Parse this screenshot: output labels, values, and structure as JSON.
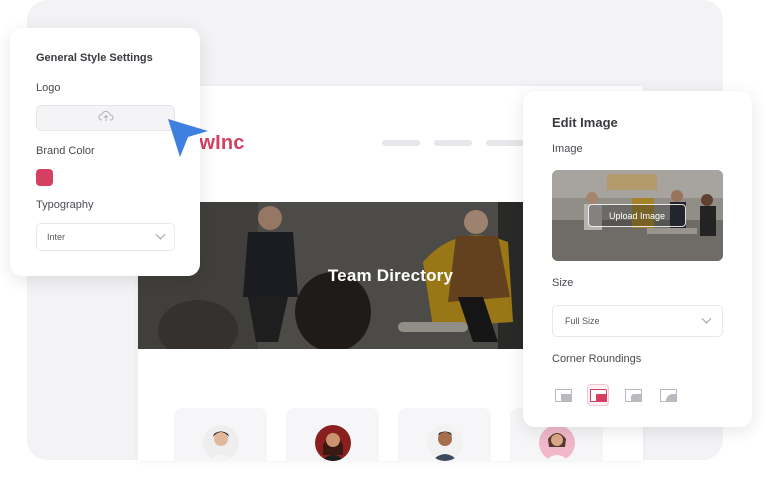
{
  "site": {
    "brand_text": "ewInc",
    "hero_title": "Team Directory"
  },
  "left_panel": {
    "title": "General Style Settings",
    "logo_label": "Logo",
    "upload_icon": "cloud-upload-icon",
    "brand_color_label": "Brand Color",
    "brand_color": "#d43f62",
    "typography_label": "Typography",
    "typography_value": "Inter"
  },
  "right_panel": {
    "title": "Edit Image",
    "image_label": "Image",
    "upload_button_label": "Upload Image",
    "size_label": "Size",
    "size_value": "Full Size",
    "corner_label": "Corner Roundings",
    "corner_options": [
      "none",
      "small",
      "medium",
      "large"
    ],
    "selected_corner": "small"
  },
  "colors": {
    "accent": "#d43f62",
    "cursor": "#3f7fe0"
  }
}
